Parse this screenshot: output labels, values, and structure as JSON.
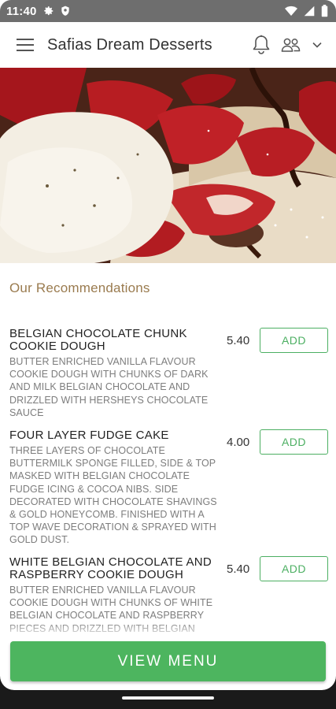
{
  "status_bar": {
    "time": "11:40",
    "left_icons": [
      "gear-icon",
      "shield-icon"
    ],
    "right_icons": [
      "wifi-icon",
      "cellular-icon",
      "battery-icon"
    ]
  },
  "app_bar": {
    "title": "Safias Dream Desserts",
    "menu_icon": "hamburger-menu-icon",
    "actions": [
      "bell-icon",
      "people-icon",
      "chevron-down-icon"
    ]
  },
  "hero": {
    "image_subject": "waffle with strawberries, chocolate sauce and vanilla ice cream"
  },
  "recommendations": {
    "title": "Our Recommendations",
    "items": [
      {
        "name": "BELGIAN CHOCOLATE CHUNK COOKIE DOUGH",
        "description": "BUTTER ENRICHED VANILLA FLAVOUR COOKIE DOUGH WITH CHUNKS OF DARK AND MILK BELGIAN CHOCOLATE AND DRIZZLED WITH HERSHEYS CHOCOLATE SAUCE",
        "price": "5.40",
        "add_label": "ADD"
      },
      {
        "name": "FOUR LAYER FUDGE CAKE",
        "description": "THREE LAYERS OF CHOCOLATE BUTTERMILK SPONGE FILLED, SIDE & TOP MASKED WITH BELGIAN CHOCOLATE FUDGE ICING & COCOA NIBS. SIDE DECORATED WITH CHOCOLATE SHAVINGS & GOLD HONEYCOMB. FINISHED WITH A TOP WAVE DECORATION & SPRAYED WITH GOLD DUST.",
        "price": "4.00",
        "add_label": "ADD"
      },
      {
        "name": "WHITE BELGIAN CHOCOLATE AND RASPBERRY COOKIE DOUGH",
        "description": "BUTTER ENRICHED VANILLA FLAVOUR COOKIE DOUGH WITH CHUNKS OF WHITE BELGIAN CHOCOLATE AND RASPBERRY PIECES AND DRIZZLED WITH BELGIAN",
        "price": "5.40",
        "add_label": "ADD"
      }
    ]
  },
  "footer": {
    "view_menu_label": "VIEW MENU"
  },
  "colors": {
    "accent_green": "#4db55f",
    "section_title": "#9a7b4f",
    "status_bar": "#6e6e6e"
  }
}
